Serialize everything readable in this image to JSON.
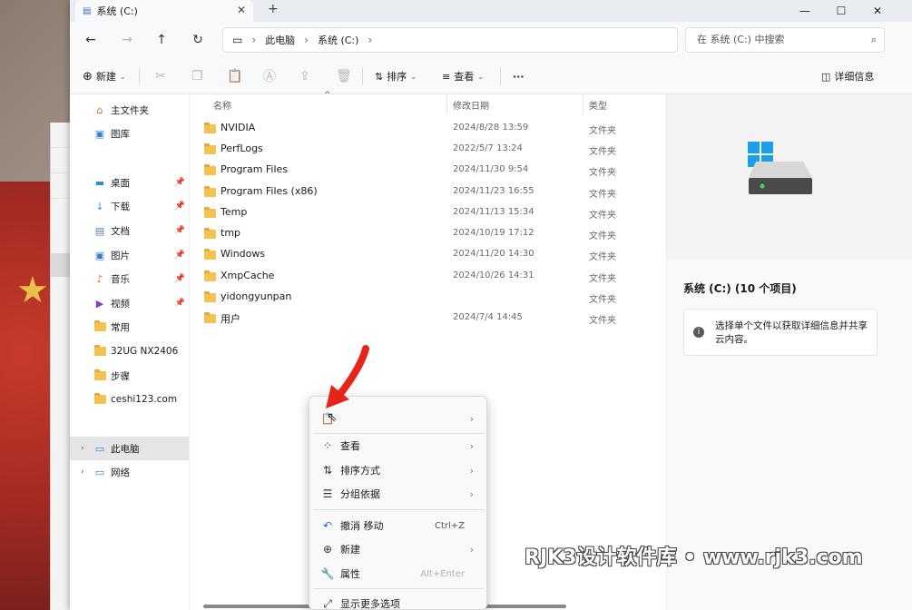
{
  "tab": {
    "title": "系统 (C:)"
  },
  "nav": {
    "breadcrumb": [
      "此电脑",
      "系统 (C:)"
    ],
    "search_placeholder": "在 系统 (C:) 中搜索"
  },
  "toolbar": {
    "new_label": "新建",
    "sort_label": "排序",
    "view_label": "查看",
    "more_label": "···",
    "details_label": "详细信息"
  },
  "sidebar": {
    "items": [
      {
        "label": "主文件夹",
        "icon": "home-icon"
      },
      {
        "label": "图库",
        "icon": "gallery-icon"
      },
      {
        "label": "桌面",
        "icon": "desktop-icon",
        "pinned": true
      },
      {
        "label": "下载",
        "icon": "download-icon",
        "pinned": true
      },
      {
        "label": "文档",
        "icon": "document-icon",
        "pinned": true
      },
      {
        "label": "图片",
        "icon": "pictures-icon",
        "pinned": true
      },
      {
        "label": "音乐",
        "icon": "music-icon",
        "pinned": true
      },
      {
        "label": "视频",
        "icon": "video-icon",
        "pinned": true
      },
      {
        "label": "常用",
        "icon": "folder-icon"
      },
      {
        "label": "32UG NX2406",
        "icon": "folder-icon"
      },
      {
        "label": "步骤",
        "icon": "folder-icon"
      },
      {
        "label": "ceshi123.com",
        "icon": "folder-icon"
      },
      {
        "label": "此电脑",
        "icon": "computer-icon"
      },
      {
        "label": "网络",
        "icon": "network-icon"
      }
    ]
  },
  "columns": {
    "name": "名称",
    "date": "修改日期",
    "type": "类型"
  },
  "files": [
    {
      "name": "NVIDIA",
      "date": "2024/8/28 13:59",
      "type": "文件夹"
    },
    {
      "name": "PerfLogs",
      "date": "2022/5/7 13:24",
      "type": "文件夹"
    },
    {
      "name": "Program Files",
      "date": "2024/11/30 9:54",
      "type": "文件夹"
    },
    {
      "name": "Program Files (x86)",
      "date": "2024/11/23 16:55",
      "type": "文件夹"
    },
    {
      "name": "Temp",
      "date": "2024/11/13 15:34",
      "type": "文件夹"
    },
    {
      "name": "tmp",
      "date": "2024/10/19 17:12",
      "type": "文件夹"
    },
    {
      "name": "Windows",
      "date": "2024/11/20 14:30",
      "type": "文件夹"
    },
    {
      "name": "XmpCache",
      "date": "2024/10/26 14:31",
      "type": "文件夹"
    },
    {
      "name": "yidongyunpan",
      "date": "",
      "type": "文件夹"
    },
    {
      "name": "用户",
      "date": "2024/7/4 14:45",
      "type": "文件夹"
    }
  ],
  "details": {
    "title": "系统 (C:) (10 个项目)",
    "hint": "选择单个文件以获取详细信息并共享云内容。"
  },
  "context_menu": {
    "view": "查看",
    "sort": "排序方式",
    "group": "分组依据",
    "undo": "撤消 移动",
    "undo_key": "Ctrl+Z",
    "new": "新建",
    "properties": "属性",
    "properties_key": "Alt+Enter",
    "more": "显示更多选项"
  },
  "watermark": "RJK3设计软件库 • www.rjk3.com",
  "colors": {
    "folder": "#f4c34f",
    "accent": "#0067c0",
    "arrow": "#e8231b"
  }
}
